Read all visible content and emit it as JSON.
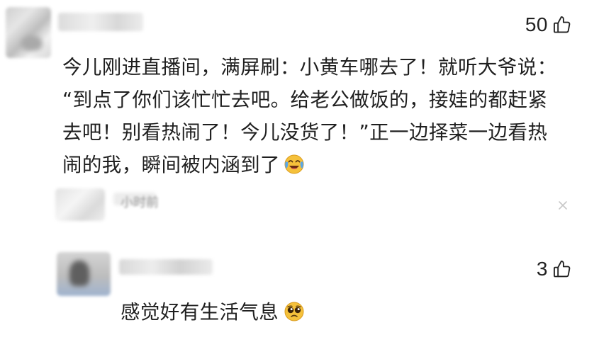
{
  "comments": [
    {
      "likes": "50",
      "lines": [
        "今儿刚进直播间，满屏刷：小黄车哪去了！就听大爷说：",
        "“到点了你们该忙忙去吧。给老公做饭的，接娃的都赶紧",
        "去吧！别看热闹了！今儿没货了！”正一边择菜一边看热",
        "闹的我，瞬间被内涵到了"
      ],
      "trailing_emoji": "crying-laughing-emoji",
      "reply_meta": "小时前"
    },
    {
      "likes": "3",
      "text": "感觉好有生活气息",
      "trailing_emoji": "pleading-face-emoji"
    }
  ],
  "icons": {
    "like": "thumbs-up-icon",
    "close": "close-icon"
  },
  "colors": {
    "text": "#1f1f1f",
    "meta": "#9a9a9a",
    "emoji_yellow": "#f5c13b",
    "emoji_tear": "#5aa7e8"
  }
}
